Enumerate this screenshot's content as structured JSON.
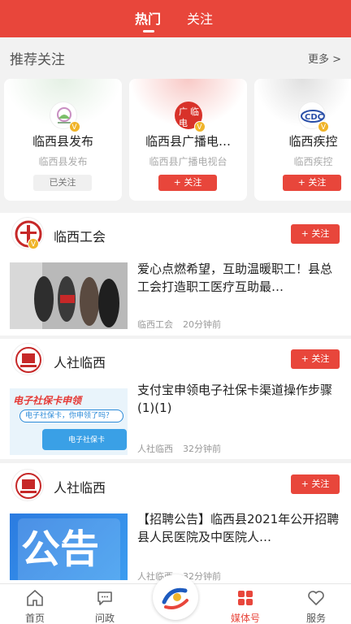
{
  "tabs": [
    {
      "label": "热门"
    },
    {
      "label": "关注"
    }
  ],
  "recommend": {
    "title": "推荐关注",
    "more": "更多 >"
  },
  "cards": [
    {
      "name": "临西县发布",
      "sub": "临西县发布",
      "button": "已关注",
      "followed": true
    },
    {
      "name": "临西县广播电…",
      "sub": "临西县广播电视台",
      "button": "+ 关注",
      "followed": false,
      "logo_text": "广 临\n电"
    },
    {
      "name": "临西疾控",
      "sub": "临西疾控",
      "button": "+ 关注",
      "followed": false
    }
  ],
  "sections": [
    {
      "account": "临西工会",
      "follow_label": "+ 关注",
      "title": "爱心点燃希望，互助温暖职工！县总工会打造职工医疗互助最…",
      "source": "临西工会",
      "time": "20分钟前"
    },
    {
      "account": "人社临西",
      "follow_label": "+ 关注",
      "title": "支付宝申领电子社保卡渠道操作步骤(1)(1)",
      "source": "人社临西",
      "time": "32分钟前",
      "thumb_text_1": "电子社保卡申领",
      "thumb_text_2": "电子社保卡，你申领了吗？",
      "thumb_text_3": "电子社保卡"
    },
    {
      "account": "人社临西",
      "follow_label": "+ 关注",
      "title": "【招聘公告】临西县2021年公开招聘县人民医院及中医院人…",
      "source": "人社临西",
      "time": "32分钟前",
      "thumb_text": "公告"
    }
  ],
  "nav": [
    {
      "label": "首页",
      "icon": "home-icon"
    },
    {
      "label": "问政",
      "icon": "chat-icon"
    },
    {
      "label": "",
      "icon": "center-logo-icon"
    },
    {
      "label": "媒体号",
      "icon": "grid-icon",
      "active": true
    },
    {
      "label": "服务",
      "icon": "heart-icon"
    }
  ],
  "colors": {
    "accent": "#e8463b",
    "badge": "#f0b429"
  }
}
